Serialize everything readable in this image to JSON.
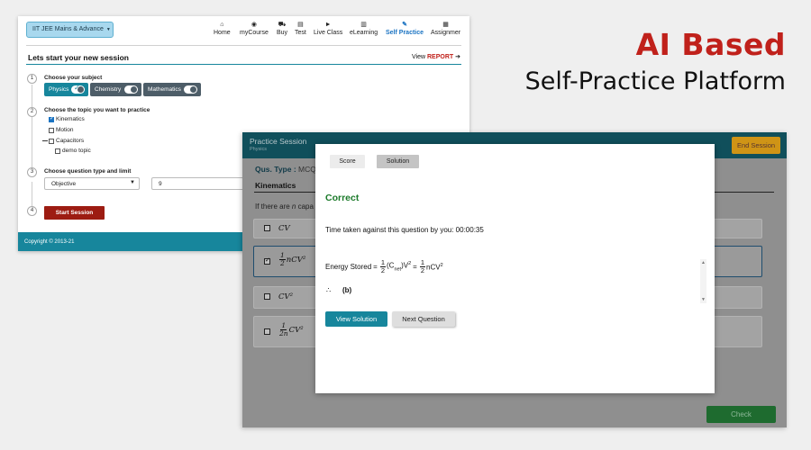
{
  "headline": {
    "line1": "AI Based",
    "line2": "Self-Practice Platform"
  },
  "topbar": {
    "course_selector": "IIT JEE Mains & Advance",
    "nav": [
      {
        "label": "Home",
        "icon": "home-icon",
        "active": false
      },
      {
        "label": "myCourse",
        "icon": "course-icon",
        "active": false
      },
      {
        "label": "Buy",
        "icon": "cart-icon",
        "active": false
      },
      {
        "label": "Test",
        "icon": "test-icon",
        "active": false
      },
      {
        "label": "Live Class",
        "icon": "play-icon",
        "active": false
      },
      {
        "label": "eLearning",
        "icon": "elearning-icon",
        "active": false
      },
      {
        "label": "Self Practice",
        "icon": "edit-icon",
        "active": true
      },
      {
        "label": "Assignmer",
        "icon": "assignment-icon",
        "active": false
      }
    ]
  },
  "session": {
    "title": "Lets start your new session",
    "view_text": "View",
    "report_text": "REPORT",
    "steps": [
      {
        "num": "1",
        "label": "Choose your subject"
      },
      {
        "num": "2",
        "label": "Choose the topic you want to practice"
      },
      {
        "num": "3",
        "label": "Choose question type and limit"
      },
      {
        "num": "4",
        "label": ""
      }
    ],
    "subjects": [
      {
        "label": "Physics",
        "selected": true
      },
      {
        "label": "Chemistry",
        "selected": false
      },
      {
        "label": "Mathematics",
        "selected": false
      }
    ],
    "topics": [
      {
        "label": "Kinematics",
        "checked": true
      },
      {
        "label": "Motion",
        "checked": false
      },
      {
        "label": "Capacitors",
        "checked": false
      },
      {
        "label": "demo topic",
        "checked": false
      }
    ],
    "question_type": "Objective",
    "question_limit": "9",
    "start_button": "Start Session"
  },
  "footer": {
    "copyright": "Copyright © 2013-21"
  },
  "practice": {
    "title": "Practice Session",
    "subject": "Physics",
    "end_button": "End Session",
    "qtype_label": "Qus. Type :",
    "qtype_value": "MCQ",
    "topic": "Kinematics",
    "question_text_start": "If there are",
    "question_var": "n",
    "question_text_end": "capa",
    "options": [
      {
        "text": "CV",
        "checked": false
      },
      {
        "text": "nCV²",
        "prefix": "1/2",
        "checked": true
      },
      {
        "text": "CV²",
        "checked": false
      },
      {
        "text": "CV²",
        "prefix": "1/2n",
        "checked": false
      }
    ],
    "check_button": "Check"
  },
  "modal": {
    "tabs": {
      "score": "Score",
      "solution": "Solution"
    },
    "result": "Correct",
    "time_text": "Time taken against this question by you: 00:00:35",
    "energy_label": "Energy Stored",
    "answer_symbol": "∴",
    "answer": "(b)",
    "view_solution": "View Solution",
    "next_question": "Next Question"
  },
  "colors": {
    "accent": "#17869c",
    "brand_red": "#c0211b",
    "correct_green": "#1b7a2a",
    "end_session": "#cf9416"
  }
}
